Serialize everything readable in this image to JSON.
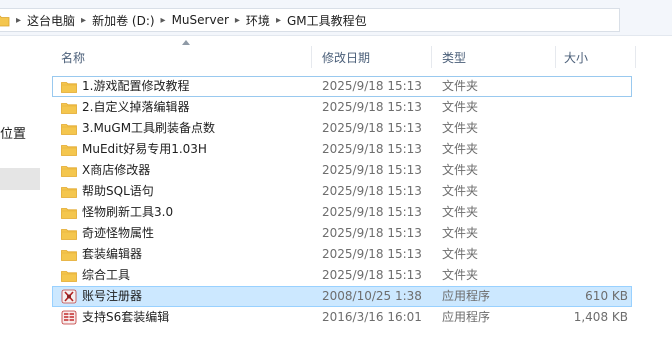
{
  "address_bar": {
    "crumbs": [
      "这台电脑",
      "新加卷 (D:)",
      "MuServer",
      "环境",
      "GM工具教程包"
    ]
  },
  "nav": {
    "partial_label": "位置"
  },
  "columns": {
    "name": "名称",
    "date": "修改日期",
    "type": "类型",
    "size": "大小"
  },
  "files": [
    {
      "name": "1.游戏配置修改教程",
      "date": "2025/9/18 15:13",
      "type": "文件夹",
      "size": "",
      "icon": "folder-icon"
    },
    {
      "name": "2.自定义掉落编辑器",
      "date": "2025/9/18 15:13",
      "type": "文件夹",
      "size": "",
      "icon": "folder-icon"
    },
    {
      "name": "3.MuGM工具刷装备点数",
      "date": "2025/9/18 15:13",
      "type": "文件夹",
      "size": "",
      "icon": "folder-icon"
    },
    {
      "name": "MuEdit好易专用1.03H",
      "date": "2025/9/18 15:13",
      "type": "文件夹",
      "size": "",
      "icon": "folder-icon"
    },
    {
      "name": "X商店修改器",
      "date": "2025/9/18 15:13",
      "type": "文件夹",
      "size": "",
      "icon": "folder-icon"
    },
    {
      "name": "帮助SQL语句",
      "date": "2025/9/18 15:13",
      "type": "文件夹",
      "size": "",
      "icon": "folder-icon"
    },
    {
      "name": "怪物刷新工具3.0",
      "date": "2025/9/18 15:13",
      "type": "文件夹",
      "size": "",
      "icon": "folder-icon"
    },
    {
      "name": "奇迹怪物属性",
      "date": "2025/9/18 15:13",
      "type": "文件夹",
      "size": "",
      "icon": "folder-icon"
    },
    {
      "name": "套装编辑器",
      "date": "2025/9/18 15:13",
      "type": "文件夹",
      "size": "",
      "icon": "folder-icon"
    },
    {
      "name": "综合工具",
      "date": "2025/9/18 15:13",
      "type": "文件夹",
      "size": "",
      "icon": "folder-icon"
    },
    {
      "name": "账号注册器",
      "date": "2008/10/25 1:38",
      "type": "应用程序",
      "size": "610 KB",
      "icon": "app-icon"
    },
    {
      "name": "支持S6套装编辑",
      "date": "2016/3/16 16:01",
      "type": "应用程序",
      "size": "1,408 KB",
      "icon": "app-icon"
    }
  ],
  "colors": {
    "folder": "#f4c64e",
    "folder_dark": "#e2a82b",
    "selection": "#cce8ff",
    "header_text": "#4c607a"
  }
}
